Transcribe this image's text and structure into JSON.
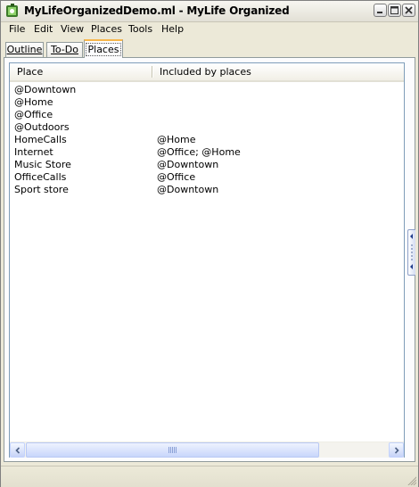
{
  "window": {
    "title": "MyLifeOrganizedDemo.ml - MyLife Organized"
  },
  "menu": [
    "File",
    "Edit",
    "View",
    "Places",
    "Tools",
    "Help"
  ],
  "tabs": [
    {
      "label": "Outline",
      "active": false
    },
    {
      "label": "To-Do",
      "active": false
    },
    {
      "label": "Places",
      "active": true
    }
  ],
  "table": {
    "columns": [
      "Place",
      "Included by places"
    ],
    "rows": [
      {
        "place": "@Downtown",
        "included": ""
      },
      {
        "place": "@Home",
        "included": ""
      },
      {
        "place": "@Office",
        "included": ""
      },
      {
        "place": "@Outdoors",
        "included": ""
      },
      {
        "place": "HomeCalls",
        "included": "@Home"
      },
      {
        "place": "Internet",
        "included": "@Office; @Home"
      },
      {
        "place": "Music Store",
        "included": "@Downtown"
      },
      {
        "place": "OfficeCalls",
        "included": "@Office"
      },
      {
        "place": "Sport store",
        "included": "@Downtown"
      }
    ]
  },
  "icons": {
    "app": "mlo-app-icon",
    "minimize": "minimize-icon",
    "maximize": "maximize-icon",
    "close": "close-icon"
  },
  "colors": {
    "active_tab_accent": "#f7b64b",
    "close_button": "#e24a2a"
  }
}
